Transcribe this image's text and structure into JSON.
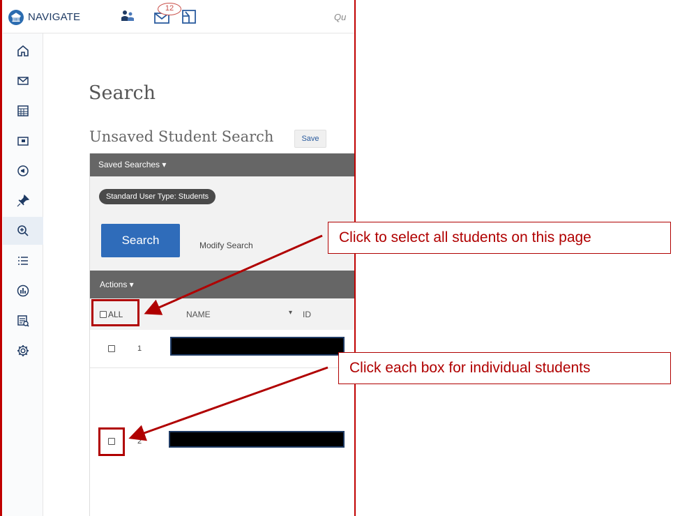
{
  "topbar": {
    "brand": "NAVIGATE",
    "badge_count": "12",
    "quick_search_text": "Qu"
  },
  "sidenav": {
    "items": [
      {
        "icon": "home-icon"
      },
      {
        "icon": "mail-icon"
      },
      {
        "icon": "calendar-icon"
      },
      {
        "icon": "folder-icon"
      },
      {
        "icon": "megaphone-icon"
      },
      {
        "icon": "pin-icon"
      },
      {
        "icon": "search-zoom-icon",
        "active": true
      },
      {
        "icon": "list-icon"
      },
      {
        "icon": "chart-icon"
      },
      {
        "icon": "report-icon"
      },
      {
        "icon": "gear-icon"
      }
    ]
  },
  "main": {
    "page_title": "Search",
    "search_title": "Unsaved Student Search",
    "save_label": "Save",
    "saved_searches_label": "Saved Searches ▾",
    "filter_chip": "Standard User Type: Students",
    "search_button": "Search",
    "modify_link": "Modify Search",
    "actions_label": "Actions ▾",
    "table": {
      "select_all_label": "ALL",
      "col_name": "NAME",
      "col_sort_arrow": "▾",
      "col_id": "ID",
      "rows": [
        {
          "index": "1"
        },
        {
          "index": "2"
        }
      ]
    }
  },
  "annotations": {
    "callout_select_all": "Click to select all students on this page",
    "callout_individual": "Click each box for individual students"
  },
  "colors": {
    "annotation_red": "#b00000",
    "primary_blue": "#2f6cba",
    "bar_gray": "#666666"
  }
}
